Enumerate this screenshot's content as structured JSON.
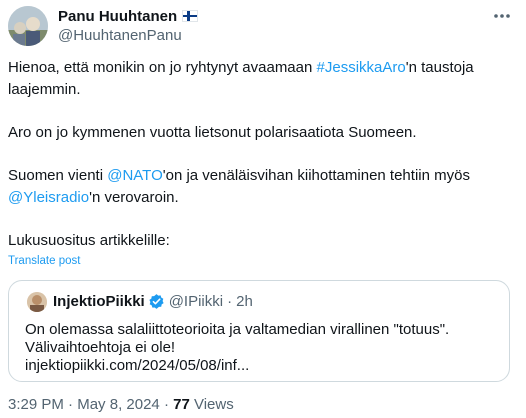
{
  "author": {
    "name": "Panu Huuhtanen",
    "handle": "@HuuhtanenPanu",
    "flag_icon": "finland-flag-icon"
  },
  "tweet": {
    "line1_pre": "Hienoa, että monikin on jo ryhtynyt avaamaan ",
    "line1_hashtag": "#JessikkaAro",
    "line1_post": "'n taustoja",
    "line2": "laajemmin.",
    "line3": "Aro on jo kymmenen vuotta lietsonut polarisaatiota Suomeen.",
    "line4_pre": "Suomen vienti ",
    "line4_mention": "@NATO",
    "line4_post": "'on ja venäläisvihan kiihottaminen tehtiin myös",
    "line5_mention": "@Yleisradio",
    "line5_post": "'n verovaroin.",
    "line6": "Lukusuositus artikkelille:",
    "translate": "Translate post"
  },
  "quote": {
    "name": "InjektioPiikki",
    "handle": "@IPiikki",
    "separator": "·",
    "time": "2h",
    "line1": "On olemassa salaliittoteorioita ja valtamedian virallinen \"totuus\".",
    "line2": "Välivaihtoehtoja ei ole!",
    "line3": "injektiopiikki.com/2024/05/08/inf..."
  },
  "meta": {
    "time": "3:29 PM",
    "sep1": "·",
    "date": "May 8, 2024",
    "sep2": "·",
    "views_count": "77",
    "views_label": "Views"
  },
  "colors": {
    "link": "#1d9bf0",
    "secondary": "#536471",
    "border": "#cfd9de",
    "verified": "#1d9bf0"
  }
}
